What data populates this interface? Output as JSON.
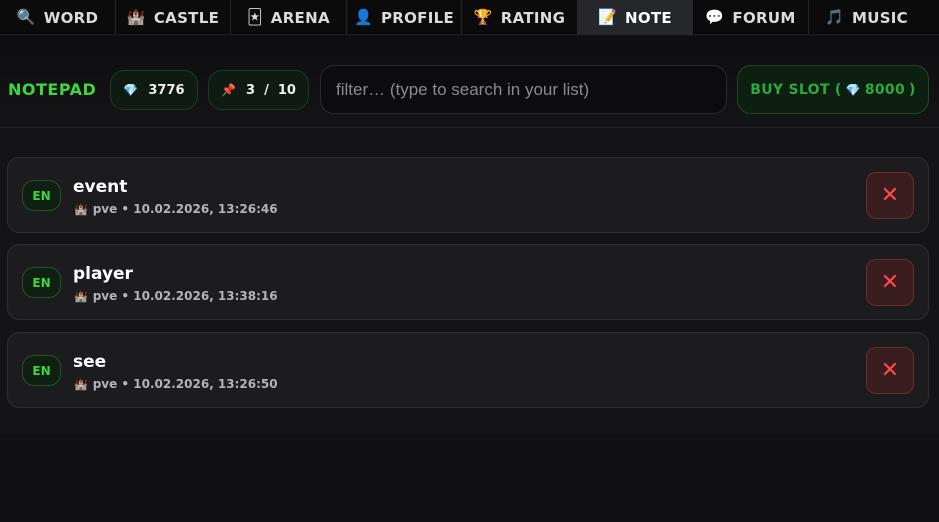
{
  "nav": {
    "tabs": [
      {
        "icon": "🔍",
        "icon_name": "magnifier-icon",
        "label": "WORD"
      },
      {
        "icon": "🏰",
        "icon_name": "castle-icon",
        "label": "CASTLE"
      },
      {
        "icon": "🃏",
        "icon_name": "card-icon",
        "label": "ARENA"
      },
      {
        "icon": "👤",
        "icon_name": "profile-bust-icon",
        "label": "PROFILE"
      },
      {
        "icon": "🏆",
        "icon_name": "trophy-icon",
        "label": "RATING"
      },
      {
        "icon": "📝",
        "icon_name": "notepad-icon",
        "label": "NOTE",
        "active": true
      },
      {
        "icon": "💬",
        "icon_name": "speech-bubble-icon",
        "label": "FORUM"
      },
      {
        "icon": "🎵",
        "icon_name": "music-note-icon",
        "label": "MUSIC"
      }
    ]
  },
  "toolbar": {
    "title": "NOTEPAD",
    "gems": {
      "icon": "💎",
      "icon_name": "diamond-icon",
      "value": "3776"
    },
    "slots": {
      "icon": "📌",
      "icon_name": "pin-icon",
      "value": "3  /  10"
    },
    "filter_placeholder": "filter… (type to search in your list)",
    "filter_value": "",
    "buy": {
      "prefix": "BUY SLOT (",
      "gem_icon": "💎",
      "price": "8000",
      "suffix": ")"
    }
  },
  "colors": {
    "accent_green": "#3ed63e",
    "buy_green": "#2fa83a",
    "delete_red": "#ff4a4a",
    "gem_blue": "#58c6f0"
  },
  "notes": [
    {
      "lang": "EN",
      "word": "event",
      "castle_icon": "🏰",
      "meta": "pve • 10.02.2026, 13:26:46",
      "delete": "✕"
    },
    {
      "lang": "EN",
      "word": "player",
      "castle_icon": "🏰",
      "meta": "pve • 10.02.2026, 13:38:16",
      "delete": "✕"
    },
    {
      "lang": "EN",
      "word": "see",
      "castle_icon": "🏰",
      "meta": "pve • 10.02.2026, 13:26:50",
      "delete": "✕"
    }
  ]
}
